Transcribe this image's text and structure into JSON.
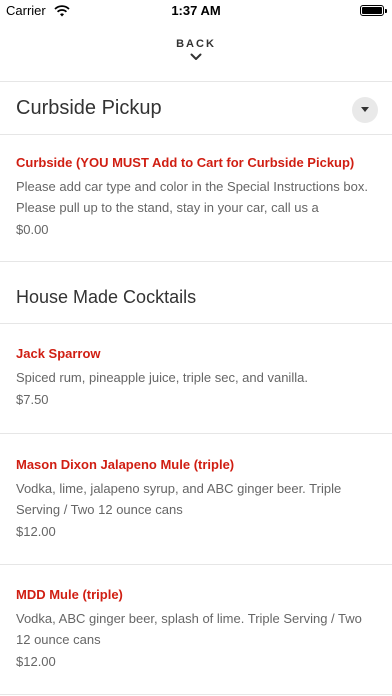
{
  "status_bar": {
    "carrier": "Carrier",
    "time": "1:37 AM"
  },
  "nav": {
    "back_label": "BACK"
  },
  "sections": [
    {
      "title": "Curbside Pickup",
      "items": [
        {
          "name": "Curbside (YOU MUST Add to Cart for Curbside Pickup)",
          "description": "Please add car type and color in the Special Instructions box. Please pull up to the stand, stay in your car, call us a",
          "price": "$0.00"
        }
      ]
    },
    {
      "title": "House Made Cocktails",
      "items": [
        {
          "name": "Jack Sparrow",
          "description": "Spiced rum, pineapple juice, triple sec, and vanilla.",
          "price": "$7.50"
        },
        {
          "name": "Mason Dixon Jalapeno Mule (triple)",
          "description": "Vodka, lime, jalapeno syrup, and ABC ginger beer. Triple Serving / Two 12 ounce cans",
          "price": "$12.00"
        },
        {
          "name": "MDD Mule (triple)",
          "description": "Vodka, ABC ginger beer, splash of lime. Triple Serving / Two 12 ounce cans",
          "price": "$12.00"
        }
      ]
    }
  ],
  "colors": {
    "accent": "#d01e12",
    "text_muted": "#666666",
    "divider": "#e6e6e6"
  }
}
